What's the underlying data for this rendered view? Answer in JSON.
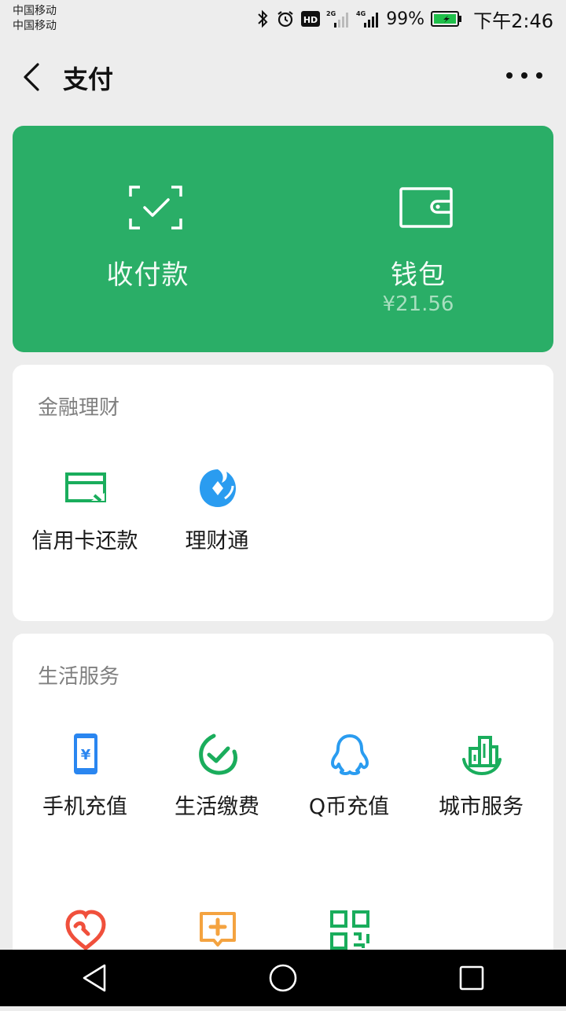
{
  "status_bar": {
    "carrier1": "中国移动",
    "carrier2": "中国移动",
    "battery": "99%",
    "time": "下午2:46"
  },
  "header": {
    "title": "支付"
  },
  "wallet_card": {
    "pay_label": "收付款",
    "wallet_label": "钱包",
    "wallet_balance": "¥21.56",
    "bg_color": "#2aae67"
  },
  "finance": {
    "title": "金融理财",
    "items": [
      {
        "label": "信用卡还款",
        "icon": "credit-card-icon"
      },
      {
        "label": "理财通",
        "icon": "licaitong-icon"
      }
    ]
  },
  "life": {
    "title": "生活服务",
    "items": [
      {
        "label": "手机充值",
        "icon": "phone-recharge-icon"
      },
      {
        "label": "生活缴费",
        "icon": "utility-payment-icon"
      },
      {
        "label": "Q币充值",
        "icon": "qq-coin-icon"
      },
      {
        "label": "城市服务",
        "icon": "city-service-icon"
      }
    ],
    "row2_icons": [
      "charity-heart-icon",
      "medical-plus-icon",
      "qr-code-icon"
    ]
  }
}
